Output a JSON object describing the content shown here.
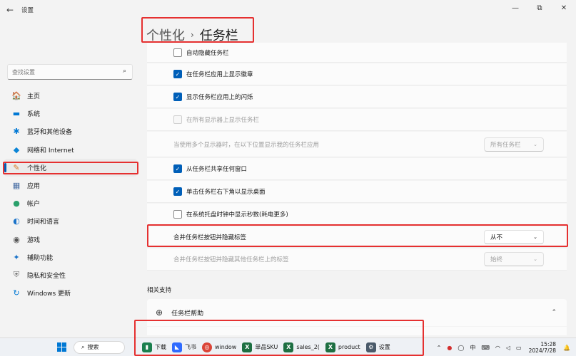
{
  "window": {
    "title": "设置",
    "back": "←",
    "minimize": "—",
    "maximize": "⧉",
    "close": "✕"
  },
  "breadcrumb": {
    "parent": "个性化",
    "separator": "›",
    "current": "任务栏"
  },
  "search": {
    "placeholder": "查找设置"
  },
  "sidebar": {
    "items": [
      {
        "label": "主页",
        "icon": "🏠"
      },
      {
        "label": "系统",
        "icon": "▬"
      },
      {
        "label": "蓝牙和其他设备",
        "icon": "✱"
      },
      {
        "label": "网络和 Internet",
        "icon": "◆"
      },
      {
        "label": "个性化",
        "icon": "✎"
      },
      {
        "label": "应用",
        "icon": "▦"
      },
      {
        "label": "帐户",
        "icon": "●"
      },
      {
        "label": "时间和语言",
        "icon": "◐"
      },
      {
        "label": "游戏",
        "icon": "◉"
      },
      {
        "label": "辅助功能",
        "icon": "✦"
      },
      {
        "label": "隐私和安全性",
        "icon": "⛨"
      },
      {
        "label": "Windows 更新",
        "icon": "↻"
      }
    ]
  },
  "settings": {
    "auto_hide": "自动隐藏任务栏",
    "show_badges": "在任务栏应用上显示徽章",
    "show_flashing": "显示任务栏应用上的闪烁",
    "show_all_displays": "在所有显示器上显示任务栏",
    "multi_display_label": "当使用多个显示器时，在以下位置显示我的任务栏应用",
    "multi_display_value": "所有任务栏",
    "share_window": "从任务栏共享任何窗口",
    "corner_show_desktop": "单击任务栏右下角以显示桌面",
    "show_seconds": "在系统托盘时钟中显示秒数(耗电更多)",
    "combine_label": "合并任务栏按钮并隐藏标签",
    "combine_value": "从不",
    "combine_other_label": "合并任务栏按钮并隐藏其他任务栏上的标签",
    "combine_other_value": "始终"
  },
  "related": {
    "title": "相关支持",
    "help": "任务栏帮助"
  },
  "taskbar": {
    "search": "搜索",
    "apps": [
      {
        "label": "下载",
        "color": "#1a7f4e",
        "glyph": "▮"
      },
      {
        "label": "飞书",
        "color": "#2f6bff",
        "glyph": "◣"
      },
      {
        "label": "window",
        "color": "#db4437",
        "glyph": "◎"
      },
      {
        "label": "单品SKU",
        "color": "#1d6f42",
        "glyph": "X"
      },
      {
        "label": "sales_2(",
        "color": "#1d6f42",
        "glyph": "X"
      },
      {
        "label": "product",
        "color": "#1d6f42",
        "glyph": "X"
      },
      {
        "label": "设置",
        "color": "#4a5a6a",
        "glyph": "⚙"
      }
    ],
    "tray": {
      "ime": "中",
      "time": "15:28",
      "date": "2024/7/28"
    }
  },
  "colors": {
    "accent": "#005fb8",
    "highlight": "#e53030"
  }
}
